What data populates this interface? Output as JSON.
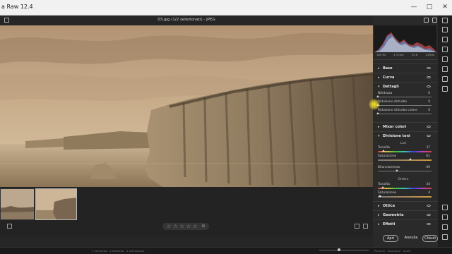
{
  "window": {
    "app_title": "a Raw 12.4",
    "buttons": [
      "—",
      "□",
      "✕"
    ]
  },
  "header": {
    "file_title": "03.jpg (1/2 selezionati)  -  JPEG"
  },
  "histogram": {
    "info": [
      "160 64",
      "4,3 mm",
      "f/2,8",
      "1/250s"
    ]
  },
  "panels": {
    "base": "Base",
    "curve": "Curva",
    "details": "Dettagli",
    "mixer": "Mixer colori",
    "split_toning": "Divisione toni",
    "optics": "Ottica",
    "geometry": "Geometria",
    "effects": "Effetti"
  },
  "details": {
    "sharpening": {
      "label": "Nitidezza",
      "value": "0",
      "level": 0.0
    },
    "noise": {
      "label": "Riduzione disturbo",
      "value": "0",
      "level": 0.0
    },
    "color_noise": {
      "label": "Riduzione disturbo colore",
      "value": "0",
      "level": 0.0
    }
  },
  "split_toning": {
    "highlights_heading": "Luci",
    "highlights_hue": {
      "label": "Tonalità",
      "value": "37",
      "level": 0.1
    },
    "highlights_saturation": {
      "label": "Saturazione",
      "value": "61",
      "level": 0.61
    },
    "balance": {
      "label": "Bilanciamento",
      "value": "-30",
      "level": 0.35
    },
    "shadows_heading": "Ombre",
    "shadows_hue": {
      "label": "Tonalità",
      "value": "34",
      "level": 0.09
    },
    "shadows_saturation": {
      "label": "Saturazione",
      "value": "4",
      "level": 0.04
    }
  },
  "footer": {
    "workspace_link": "Adobe RGB (1998) - 8 bit - 706 x 231 (0,4 MP) - 300 ppi",
    "open_label": "Apri",
    "cancel_label": "Annulla",
    "close_label": "Chiudi"
  },
  "rating": {
    "stars": [
      "☆",
      "☆",
      "☆",
      "☆",
      "☆"
    ],
    "clear": "⊘"
  },
  "status": {
    "left_text": "1 elemento  ·  2 elementi  ·  1 selezionato",
    "right_text": "Pannelli  ·  Visualizza  ·  Zoom"
  },
  "colors": {
    "accent": "#e8d84a",
    "sepia": "#b89a7a"
  }
}
